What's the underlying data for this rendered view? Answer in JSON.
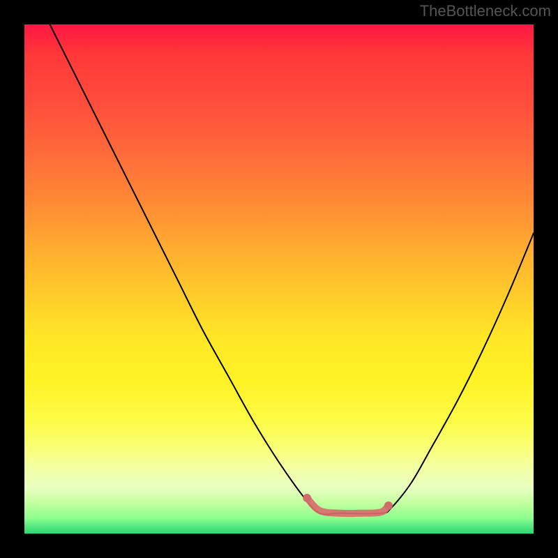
{
  "watermark": "TheBottleneck.com",
  "chart_data": {
    "type": "line",
    "title": "",
    "xlabel": "",
    "ylabel": "",
    "xlim": [
      0,
      1
    ],
    "ylim": [
      0,
      1
    ],
    "background": {
      "gradient_direction": "vertical",
      "stops": [
        {
          "pos": 0.0,
          "color": "#ff1744"
        },
        {
          "pos": 0.15,
          "color": "#ff4c3d"
        },
        {
          "pos": 0.35,
          "color": "#ff8a35"
        },
        {
          "pos": 0.55,
          "color": "#ffd229"
        },
        {
          "pos": 0.7,
          "color": "#fff225"
        },
        {
          "pos": 0.88,
          "color": "#f4ffa3"
        },
        {
          "pos": 0.97,
          "color": "#8bff8c"
        },
        {
          "pos": 1.0,
          "color": "#2dd673"
        }
      ]
    },
    "series": [
      {
        "name": "bottleneck-curve",
        "stroke": "#000000",
        "stroke_width": 2,
        "x": [
          0.05,
          0.1,
          0.15,
          0.2,
          0.25,
          0.3,
          0.35,
          0.4,
          0.45,
          0.5,
          0.55,
          0.58,
          0.62,
          0.7,
          0.72,
          0.76,
          0.8,
          0.85,
          0.9,
          0.95,
          1.0
        ],
        "y": [
          1.0,
          0.9,
          0.8,
          0.7,
          0.6,
          0.5,
          0.4,
          0.31,
          0.22,
          0.14,
          0.07,
          0.04,
          0.04,
          0.04,
          0.05,
          0.1,
          0.17,
          0.26,
          0.36,
          0.47,
          0.59
        ]
      },
      {
        "name": "optimal-zone-highlight",
        "stroke": "#d96d6d",
        "stroke_width": 10,
        "x": [
          0.555,
          0.58,
          0.62,
          0.66,
          0.7,
          0.715
        ],
        "y": [
          0.07,
          0.045,
          0.04,
          0.04,
          0.042,
          0.055
        ]
      }
    ],
    "annotations": []
  }
}
